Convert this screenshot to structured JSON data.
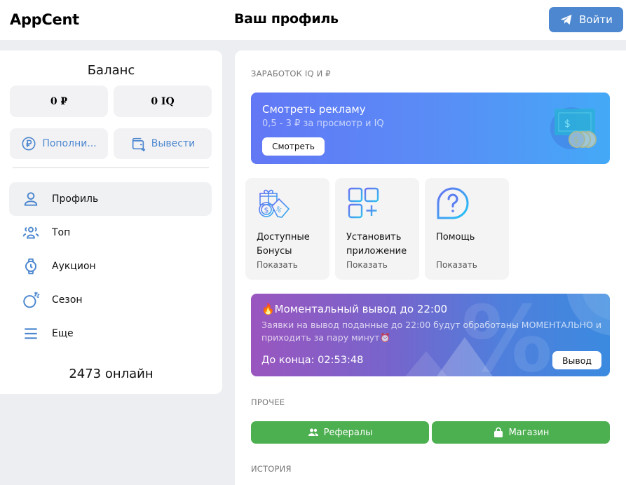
{
  "header": {
    "logo": "AppCent",
    "title": "Ваш профиль",
    "login_label": "Войти",
    "login_icon": "telegram-plane-icon"
  },
  "sidebar": {
    "balance_title": "Баланс",
    "balance_rub": "0 ₽",
    "balance_iq": "0 IQ",
    "topup_label": "Пополни...",
    "withdraw_label": "Вывести",
    "nav": [
      {
        "label": "Профиль",
        "icon": "user-icon",
        "active": true
      },
      {
        "label": "Топ",
        "icon": "users-group-icon",
        "active": false
      },
      {
        "label": "Аукцион",
        "icon": "watch-icon",
        "active": false
      },
      {
        "label": "Сезон",
        "icon": "bomb-icon",
        "active": false
      },
      {
        "label": "Еще",
        "icon": "menu-icon",
        "active": false
      }
    ],
    "online": "2473 онлайн"
  },
  "main": {
    "earn_label": "ЗАРАБОТОК IQ И ₽",
    "ad": {
      "title": "Смотреть рекламу",
      "subtitle": "0,5 - 3 ₽ за просмотр и IQ",
      "button": "Смотреть"
    },
    "tiles": [
      {
        "title": "Доступные Бонусы",
        "action": "Показать",
        "icon": "bonus-gift-icon"
      },
      {
        "title": "Установить приложение",
        "action": "Показать",
        "icon": "apps-add-icon"
      },
      {
        "title": "Помощь",
        "action": "Показать",
        "icon": "help-question-icon"
      }
    ],
    "promo": {
      "title": "🔥Моментальный вывод до 22:00",
      "text": "Заявки на вывод поданные до 22:00 будут обработаны МОМЕНТАЛЬНО и приходить за пару минут⏰",
      "timer": "До конца: 02:53:48",
      "button": "Вывод"
    },
    "other_label": "ПРОЧЕЕ",
    "referrals_label": "Рефералы",
    "shop_label": "Магазин",
    "history_label": "ИСТОРИЯ"
  },
  "colors": {
    "accent": "#4c87cf",
    "green": "#4caf50",
    "ad_gradient_start": "#6277f5",
    "ad_gradient_end": "#44a9f7",
    "promo_gradient_start": "#9a56bf",
    "promo_gradient_end": "#3b8ae0"
  }
}
